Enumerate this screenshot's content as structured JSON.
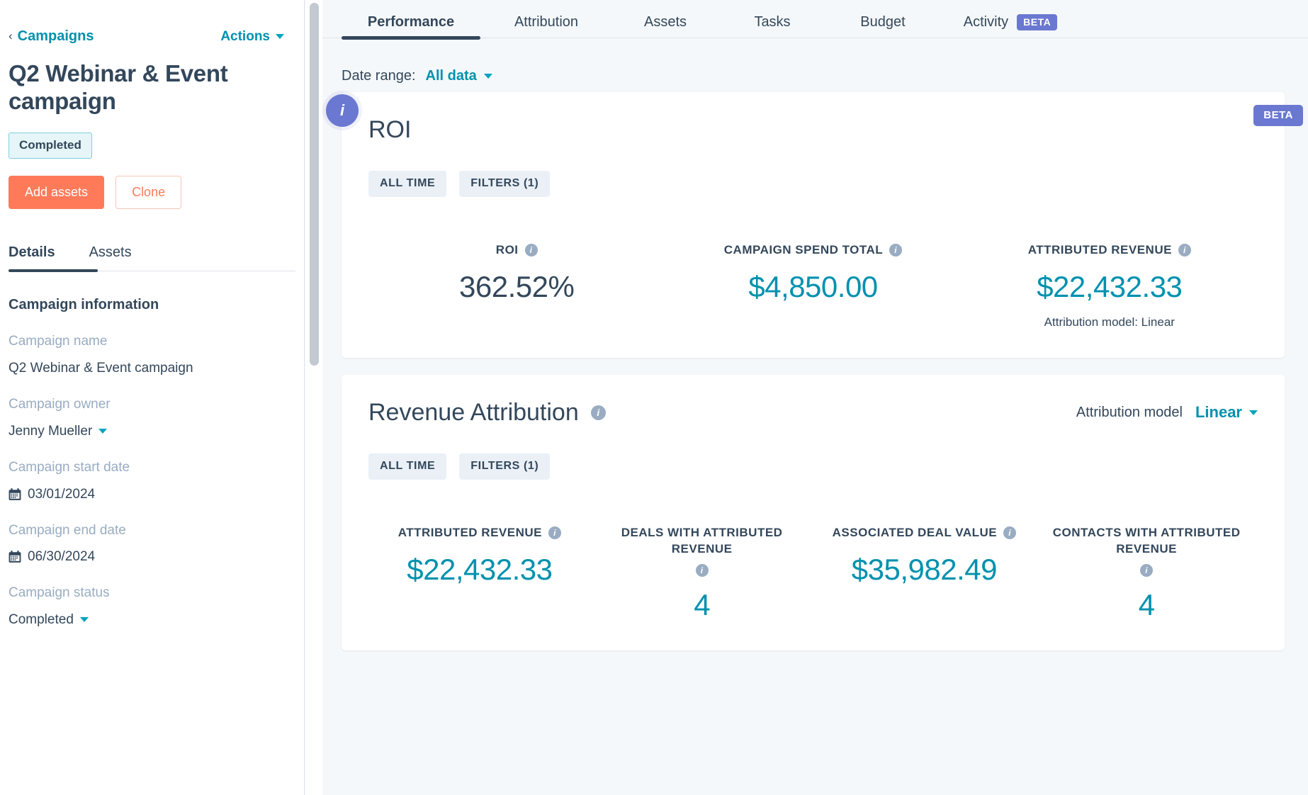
{
  "sidebar": {
    "breadcrumb": "Campaigns",
    "actions_label": "Actions",
    "page_title": "Q2 Webinar & Event campaign",
    "status_badge": "Completed",
    "primary_button": "Add assets",
    "secondary_button": "Clone",
    "tabs": [
      {
        "label": "Details",
        "active": true
      },
      {
        "label": "Assets",
        "active": false
      }
    ],
    "section_title": "Campaign information",
    "fields": [
      {
        "label": "Campaign name",
        "value": "Q2 Webinar & Event campaign",
        "icon": null,
        "caret": false
      },
      {
        "label": "Campaign owner",
        "value": "Jenny Mueller",
        "icon": null,
        "caret": true
      },
      {
        "label": "Campaign start date",
        "value": "03/01/2024",
        "icon": "calendar-icon",
        "caret": false
      },
      {
        "label": "Campaign end date",
        "value": "06/30/2024",
        "icon": "calendar-icon",
        "caret": false
      },
      {
        "label": "Campaign status",
        "value": "Completed",
        "icon": null,
        "caret": true
      }
    ]
  },
  "main": {
    "tabs": [
      {
        "label": "Performance",
        "active": true,
        "badge": null
      },
      {
        "label": "Attribution",
        "active": false,
        "badge": null
      },
      {
        "label": "Assets",
        "active": false,
        "badge": null
      },
      {
        "label": "Tasks",
        "active": false,
        "badge": null
      },
      {
        "label": "Budget",
        "active": false,
        "badge": null
      },
      {
        "label": "Activity",
        "active": false,
        "badge": "BETA"
      }
    ],
    "date_range_label": "Date range:",
    "date_range_value": "All data",
    "info_fab": "i"
  },
  "roi_card": {
    "beta_badge": "BETA",
    "title": "ROI",
    "chips": [
      "ALL TIME",
      "FILTERS (1)"
    ],
    "metrics": [
      {
        "label": "ROI",
        "value": "362.52%",
        "accent": false,
        "sub": null
      },
      {
        "label": "CAMPAIGN SPEND TOTAL",
        "value": "$4,850.00",
        "accent": true,
        "sub": null
      },
      {
        "label": "ATTRIBUTED REVENUE",
        "value": "$22,432.33",
        "accent": true,
        "sub": "Attribution model: Linear"
      }
    ]
  },
  "revenue_card": {
    "title": "Revenue Attribution",
    "attribution_model_label": "Attribution model",
    "attribution_model_value": "Linear",
    "chips": [
      "ALL TIME",
      "FILTERS (1)"
    ],
    "metrics": [
      {
        "label": "ATTRIBUTED REVENUE",
        "value": "$22,432.33",
        "accent": true
      },
      {
        "label": "DEALS WITH ATTRIBUTED REVENUE",
        "value": "4",
        "accent": true
      },
      {
        "label": "ASSOCIATED DEAL VALUE",
        "value": "$35,982.49",
        "accent": true
      },
      {
        "label": "CONTACTS WITH ATTRIBUTED REVENUE",
        "value": "4",
        "accent": true
      }
    ]
  },
  "colors": {
    "accent_teal": "#0091ae",
    "brand_orange": "#ff7a59",
    "dark_navy": "#33475b",
    "beta_purple": "#6a78d1",
    "muted": "#99acc2"
  }
}
